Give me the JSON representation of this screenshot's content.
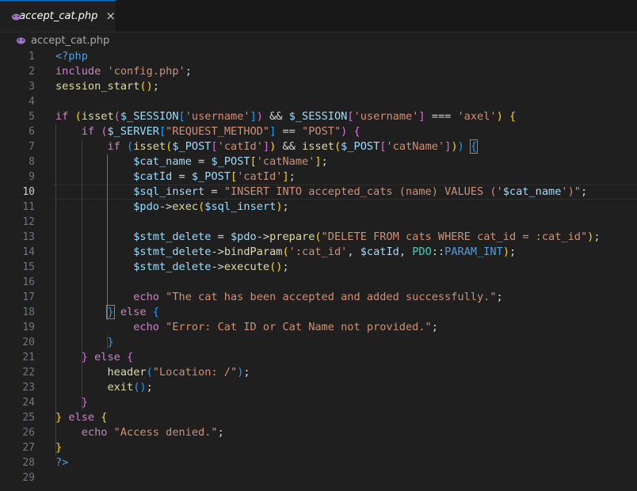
{
  "tab": {
    "label": "accept_cat.php",
    "icon": "php-icon",
    "close": "×"
  },
  "breadcrumb": {
    "label": "accept_cat.php",
    "icon": "php-icon"
  },
  "editor": {
    "active_line": 10,
    "line_numbers": [
      "1",
      "2",
      "3",
      "4",
      "5",
      "6",
      "7",
      "8",
      "9",
      "10",
      "11",
      "12",
      "13",
      "14",
      "15",
      "16",
      "17",
      "18",
      "19",
      "20",
      "21",
      "22",
      "23",
      "24",
      "25",
      "26",
      "27",
      "28",
      "29"
    ],
    "lines": [
      [
        [
          "k",
          "<?php"
        ]
      ],
      [
        [
          "kc",
          "include "
        ],
        [
          "s",
          "'config.php'"
        ],
        [
          "t",
          ";"
        ]
      ],
      [
        [
          "f",
          "session_start"
        ],
        [
          "b1",
          "()"
        ],
        [
          "t",
          ";"
        ]
      ],
      [],
      [
        [
          "kc",
          "if "
        ],
        [
          "b1",
          "("
        ],
        [
          "f",
          "isset"
        ],
        [
          "b2",
          "("
        ],
        [
          "v",
          "$_SESSION"
        ],
        [
          "b3",
          "["
        ],
        [
          "s",
          "'username'"
        ],
        [
          "b3",
          "]"
        ],
        [
          "b2",
          ")"
        ],
        [
          "t",
          " && "
        ],
        [
          "v",
          "$_SESSION"
        ],
        [
          "b2",
          "["
        ],
        [
          "s",
          "'username'"
        ],
        [
          "b2",
          "]"
        ],
        [
          "t",
          " === "
        ],
        [
          "s",
          "'axel'"
        ],
        [
          "b1",
          ")"
        ],
        [
          "t",
          " "
        ],
        [
          "b1",
          "{"
        ]
      ],
      [
        [
          "t",
          "    "
        ],
        [
          "kc",
          "if "
        ],
        [
          "b2",
          "("
        ],
        [
          "v",
          "$_SERVER"
        ],
        [
          "b3",
          "["
        ],
        [
          "s",
          "\"REQUEST_METHOD\""
        ],
        [
          "b3",
          "]"
        ],
        [
          "t",
          " == "
        ],
        [
          "s",
          "\"POST\""
        ],
        [
          "b2",
          ")"
        ],
        [
          "t",
          " "
        ],
        [
          "b2",
          "{"
        ]
      ],
      [
        [
          "t",
          "        "
        ],
        [
          "kc",
          "if "
        ],
        [
          "b3",
          "("
        ],
        [
          "f",
          "isset"
        ],
        [
          "b1",
          "("
        ],
        [
          "v",
          "$_POST"
        ],
        [
          "b2",
          "["
        ],
        [
          "s",
          "'catId'"
        ],
        [
          "b2",
          "]"
        ],
        [
          "b1",
          ")"
        ],
        [
          "t",
          " && "
        ],
        [
          "f",
          "isset"
        ],
        [
          "b1",
          "("
        ],
        [
          "v",
          "$_POST"
        ],
        [
          "b2",
          "["
        ],
        [
          "s",
          "'catName'"
        ],
        [
          "b2",
          "]"
        ],
        [
          "b1",
          ")"
        ],
        [
          "b3",
          ")"
        ],
        [
          "t",
          " "
        ],
        [
          "b3m",
          "{"
        ]
      ],
      [
        [
          "t",
          "            "
        ],
        [
          "v",
          "$cat_name"
        ],
        [
          "t",
          " = "
        ],
        [
          "v",
          "$_POST"
        ],
        [
          "b1",
          "["
        ],
        [
          "s",
          "'catName'"
        ],
        [
          "b1",
          "]"
        ],
        [
          "t",
          ";"
        ]
      ],
      [
        [
          "t",
          "            "
        ],
        [
          "v",
          "$catId"
        ],
        [
          "t",
          " = "
        ],
        [
          "v",
          "$_POST"
        ],
        [
          "b1",
          "["
        ],
        [
          "s",
          "'catId'"
        ],
        [
          "b1",
          "]"
        ],
        [
          "t",
          ";"
        ]
      ],
      [
        [
          "t",
          "            "
        ],
        [
          "v",
          "$sql_insert"
        ],
        [
          "t",
          " = "
        ],
        [
          "s",
          "\"INSERT INTO accepted_cats (name) VALUES ('"
        ],
        [
          "v",
          "$cat_name"
        ],
        [
          "s",
          "')\""
        ],
        [
          "t",
          ";"
        ]
      ],
      [
        [
          "t",
          "            "
        ],
        [
          "v",
          "$pdo"
        ],
        [
          "t",
          "->"
        ],
        [
          "f",
          "exec"
        ],
        [
          "b1",
          "("
        ],
        [
          "v",
          "$sql_insert"
        ],
        [
          "b1",
          ")"
        ],
        [
          "t",
          ";"
        ]
      ],
      [],
      [
        [
          "t",
          "            "
        ],
        [
          "v",
          "$stmt_delete"
        ],
        [
          "t",
          " = "
        ],
        [
          "v",
          "$pdo"
        ],
        [
          "t",
          "->"
        ],
        [
          "f",
          "prepare"
        ],
        [
          "b1",
          "("
        ],
        [
          "s",
          "\"DELETE FROM cats WHERE cat_id = :cat_id\""
        ],
        [
          "b1",
          ")"
        ],
        [
          "t",
          ";"
        ]
      ],
      [
        [
          "t",
          "            "
        ],
        [
          "v",
          "$stmt_delete"
        ],
        [
          "t",
          "->"
        ],
        [
          "f",
          "bindParam"
        ],
        [
          "b1",
          "("
        ],
        [
          "s",
          "':cat_id'"
        ],
        [
          "t",
          ", "
        ],
        [
          "v",
          "$catId"
        ],
        [
          "t",
          ", "
        ],
        [
          "c",
          "PDO"
        ],
        [
          "t",
          "::"
        ],
        [
          "k",
          "PARAM_INT"
        ],
        [
          "b1",
          ")"
        ],
        [
          "t",
          ";"
        ]
      ],
      [
        [
          "t",
          "            "
        ],
        [
          "v",
          "$stmt_delete"
        ],
        [
          "t",
          "->"
        ],
        [
          "f",
          "execute"
        ],
        [
          "b1",
          "()"
        ],
        [
          "t",
          ";"
        ]
      ],
      [],
      [
        [
          "t",
          "            "
        ],
        [
          "kc",
          "echo "
        ],
        [
          "s",
          "\"The cat has been accepted and added successfully.\""
        ],
        [
          "t",
          ";"
        ]
      ],
      [
        [
          "t",
          "        "
        ],
        [
          "b3m",
          "}"
        ],
        [
          "kc",
          " else "
        ],
        [
          "b3",
          "{"
        ]
      ],
      [
        [
          "t",
          "            "
        ],
        [
          "kc",
          "echo "
        ],
        [
          "s",
          "\"Error: Cat ID or Cat Name not provided.\""
        ],
        [
          "t",
          ";"
        ]
      ],
      [
        [
          "t",
          "        "
        ],
        [
          "b3",
          "}"
        ]
      ],
      [
        [
          "t",
          "    "
        ],
        [
          "b2",
          "}"
        ],
        [
          "kc",
          " else "
        ],
        [
          "b2",
          "{"
        ]
      ],
      [
        [
          "t",
          "        "
        ],
        [
          "f",
          "header"
        ],
        [
          "b3",
          "("
        ],
        [
          "s",
          "\"Location: /\""
        ],
        [
          "b3",
          ")"
        ],
        [
          "t",
          ";"
        ]
      ],
      [
        [
          "t",
          "        "
        ],
        [
          "f",
          "exit"
        ],
        [
          "b3",
          "()"
        ],
        [
          "t",
          ";"
        ]
      ],
      [
        [
          "t",
          "    "
        ],
        [
          "b2",
          "}"
        ]
      ],
      [
        [
          "b1",
          "}"
        ],
        [
          "kc",
          " else "
        ],
        [
          "b1",
          "{"
        ]
      ],
      [
        [
          "t",
          "    "
        ],
        [
          "kc",
          "echo "
        ],
        [
          "s",
          "\"Access denied.\""
        ],
        [
          "t",
          ";"
        ]
      ],
      [
        [
          "b1",
          "}"
        ]
      ],
      [
        [
          "k",
          "?>"
        ]
      ],
      []
    ]
  }
}
